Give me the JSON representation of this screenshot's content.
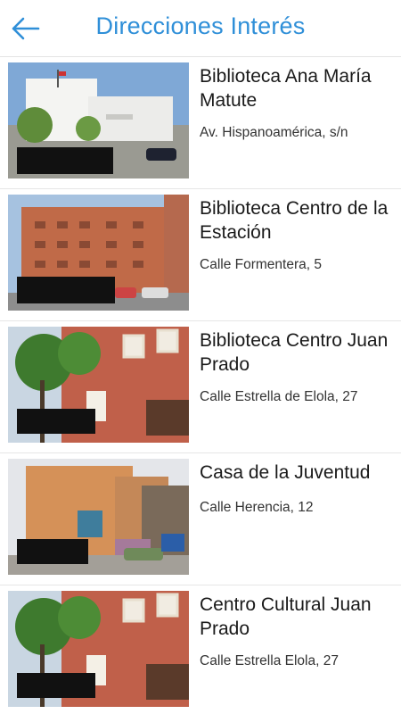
{
  "header": {
    "title": "Direcciones Interés",
    "back_icon": "arrow-left-icon",
    "accent_color": "#2f8fd8"
  },
  "places": [
    {
      "name": "Biblioteca Ana María Matute",
      "address": "Av. Hispanoamérica, s/n"
    },
    {
      "name": "Biblioteca Centro de la Estación",
      "address": "Calle Formentera, 5"
    },
    {
      "name": "Biblioteca Centro Juan Prado",
      "address": "Calle Estrella de Elola, 27"
    },
    {
      "name": "Casa de la Juventud",
      "address": "Calle Herencia, 12"
    },
    {
      "name": "Centro Cultural Juan Prado",
      "address": "Calle Estrella Elola, 27"
    }
  ]
}
